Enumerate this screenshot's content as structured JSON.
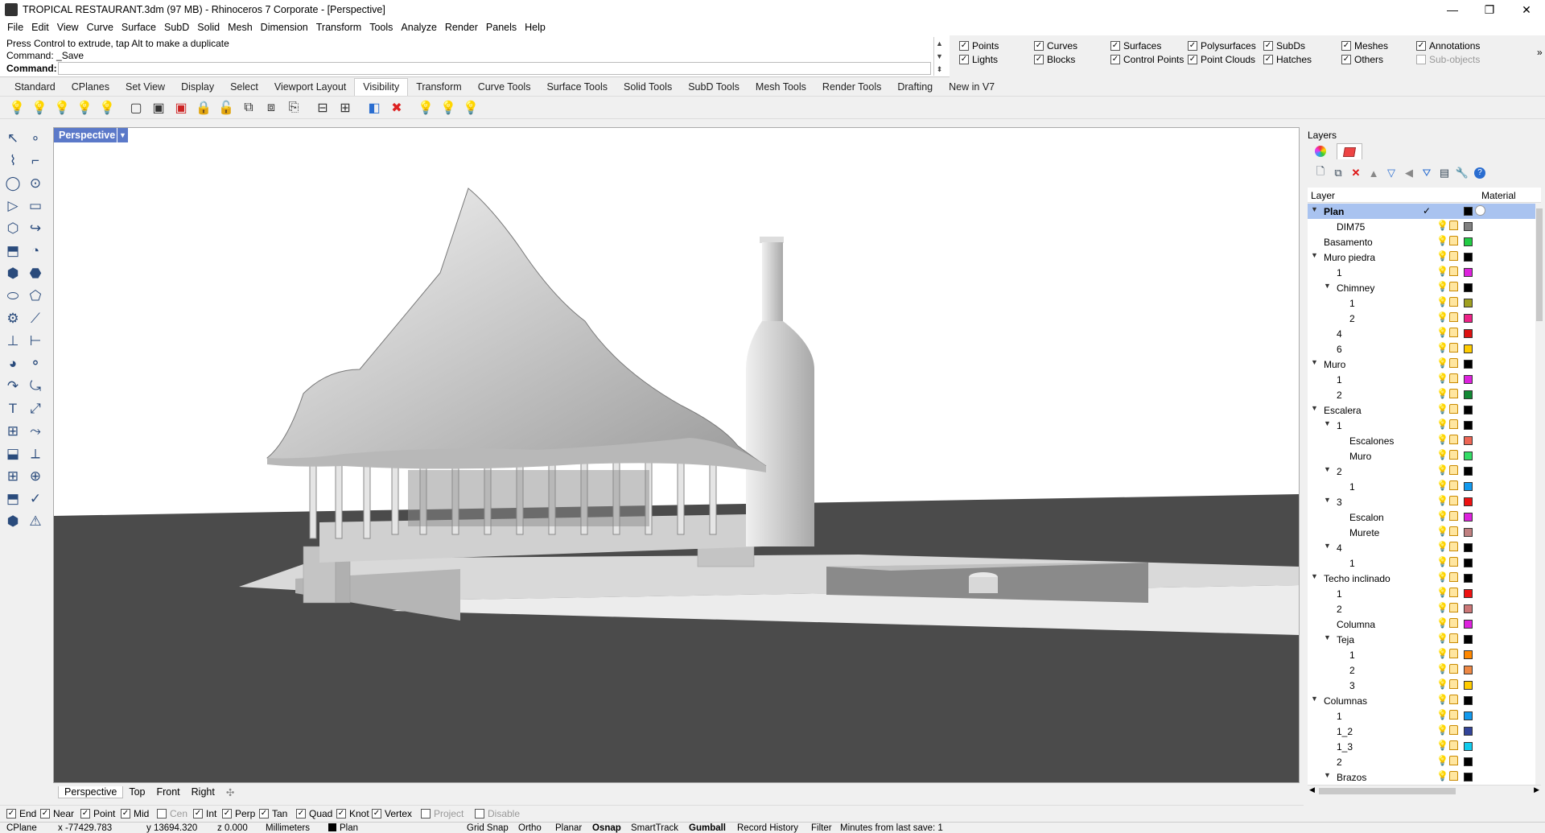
{
  "window": {
    "title": "TROPICAL RESTAURANT.3dm (97 MB) - Rhinoceros 7 Corporate - [Perspective]",
    "minimize": "—",
    "restore": "❐",
    "close": "✕"
  },
  "menu": [
    "File",
    "Edit",
    "View",
    "Curve",
    "Surface",
    "SubD",
    "Solid",
    "Mesh",
    "Dimension",
    "Transform",
    "Tools",
    "Analyze",
    "Render",
    "Panels",
    "Help"
  ],
  "command": {
    "history1": "Press Control to extrude, tap Alt to make a duplicate",
    "history2": "Command: _Save",
    "prompt": "Command:",
    "value": ""
  },
  "select_filter": [
    {
      "label": "Points",
      "checked": true
    },
    {
      "label": "Lights",
      "checked": true
    },
    {
      "label": "Curves",
      "checked": true
    },
    {
      "label": "Blocks",
      "checked": true
    },
    {
      "label": "Surfaces",
      "checked": true
    },
    {
      "label": "Control Points",
      "checked": true
    },
    {
      "label": "Polysurfaces",
      "checked": true
    },
    {
      "label": "Point Clouds",
      "checked": true
    },
    {
      "label": "SubDs",
      "checked": true
    },
    {
      "label": "Hatches",
      "checked": true
    },
    {
      "label": "Meshes",
      "checked": true
    },
    {
      "label": "Others",
      "checked": true
    },
    {
      "label": "Annotations",
      "checked": true
    },
    {
      "label": "Sub-objects",
      "checked": false
    }
  ],
  "toolbar_tabs": [
    "Standard",
    "CPlanes",
    "Set View",
    "Display",
    "Select",
    "Viewport Layout",
    "Visibility",
    "Transform",
    "Curve Tools",
    "Surface Tools",
    "Solid Tools",
    "SubD Tools",
    "Mesh Tools",
    "Render Tools",
    "Drafting",
    "New in V7"
  ],
  "active_toolbar_tab": "Visibility",
  "viewport": {
    "label": "Perspective",
    "tabs": [
      "Perspective",
      "Top",
      "Front",
      "Right"
    ],
    "add_tab": "✣"
  },
  "osnaps": [
    {
      "label": "End",
      "checked": true
    },
    {
      "label": "Near",
      "checked": true
    },
    {
      "label": "Point",
      "checked": true
    },
    {
      "label": "Mid",
      "checked": true
    },
    {
      "label": "Cen",
      "checked": false
    },
    {
      "label": "Int",
      "checked": true
    },
    {
      "label": "Perp",
      "checked": true
    },
    {
      "label": "Tan",
      "checked": true
    },
    {
      "label": "Quad",
      "checked": true
    },
    {
      "label": "Knot",
      "checked": true
    },
    {
      "label": "Vertex",
      "checked": true
    },
    {
      "label": "Project",
      "checked": false
    },
    {
      "label": "Disable",
      "checked": false
    }
  ],
  "status": {
    "cplane": "CPlane",
    "x": "x -77429.783",
    "y": "y 13694.320",
    "z": "z 0.000",
    "units": "Millimeters",
    "layer": "Plan",
    "grid_snap": "Grid Snap",
    "ortho": "Ortho",
    "planar": "Planar",
    "osnap": "Osnap",
    "smarttrack": "SmartTrack",
    "gumball": "Gumball",
    "record_history": "Record History",
    "filter": "Filter",
    "last_save": "Minutes from last save: 1"
  },
  "layers_panel": {
    "title": "Layers",
    "col_layer": "Layer",
    "col_material": "Material",
    "rows": [
      {
        "name": "Plan",
        "indent": 0,
        "expander": "down",
        "color": "#000000",
        "selected": true,
        "current": true
      },
      {
        "name": "DIM75",
        "indent": 1,
        "expander": "",
        "color": "#808080"
      },
      {
        "name": "Basamento",
        "indent": 0,
        "expander": "",
        "color": "#22cc44"
      },
      {
        "name": "Muro piedra",
        "indent": 0,
        "expander": "down",
        "color": "#000000"
      },
      {
        "name": "1",
        "indent": 1,
        "expander": "",
        "color": "#dd22dd"
      },
      {
        "name": "Chimney",
        "indent": 1,
        "expander": "down",
        "color": "#000000"
      },
      {
        "name": "1",
        "indent": 2,
        "expander": "",
        "color": "#a0a020"
      },
      {
        "name": "2",
        "indent": 2,
        "expander": "",
        "color": "#ee2288"
      },
      {
        "name": "4",
        "indent": 1,
        "expander": "",
        "color": "#dd1111"
      },
      {
        "name": "6",
        "indent": 1,
        "expander": "",
        "color": "#ffcc00"
      },
      {
        "name": "Muro",
        "indent": 0,
        "expander": "down",
        "color": "#000000"
      },
      {
        "name": "1",
        "indent": 1,
        "expander": "",
        "color": "#dd22dd"
      },
      {
        "name": "2",
        "indent": 1,
        "expander": "",
        "color": "#118833"
      },
      {
        "name": "Escalera",
        "indent": 0,
        "expander": "down",
        "color": "#000000"
      },
      {
        "name": "1",
        "indent": 1,
        "expander": "down",
        "color": "#000000"
      },
      {
        "name": "Escalones",
        "indent": 2,
        "expander": "",
        "color": "#ee6655"
      },
      {
        "name": "Muro",
        "indent": 2,
        "expander": "",
        "color": "#33dd66"
      },
      {
        "name": "2",
        "indent": 1,
        "expander": "down",
        "color": "#000000"
      },
      {
        "name": "1",
        "indent": 2,
        "expander": "",
        "color": "#1199ee"
      },
      {
        "name": "3",
        "indent": 1,
        "expander": "down",
        "color": "#ee1111"
      },
      {
        "name": "Escalon",
        "indent": 2,
        "expander": "",
        "color": "#dd22dd"
      },
      {
        "name": "Murete",
        "indent": 2,
        "expander": "",
        "color": "#c08080"
      },
      {
        "name": "4",
        "indent": 1,
        "expander": "down",
        "color": "#000000"
      },
      {
        "name": "1",
        "indent": 2,
        "expander": "",
        "color": "#000000"
      },
      {
        "name": "Techo inclinado",
        "indent": 0,
        "expander": "down",
        "color": "#000000"
      },
      {
        "name": "1",
        "indent": 1,
        "expander": "",
        "color": "#ee1111"
      },
      {
        "name": "2",
        "indent": 1,
        "expander": "",
        "color": "#cc7777"
      },
      {
        "name": "Columna",
        "indent": 1,
        "expander": "",
        "color": "#dd22dd"
      },
      {
        "name": "Teja",
        "indent": 1,
        "expander": "down",
        "color": "#000000"
      },
      {
        "name": "1",
        "indent": 2,
        "expander": "",
        "color": "#ff8800"
      },
      {
        "name": "2",
        "indent": 2,
        "expander": "",
        "color": "#ee8844"
      },
      {
        "name": "3",
        "indent": 2,
        "expander": "",
        "color": "#ffcc00"
      },
      {
        "name": "Columnas",
        "indent": 0,
        "expander": "down",
        "color": "#000000"
      },
      {
        "name": "1",
        "indent": 1,
        "expander": "",
        "color": "#1199ee"
      },
      {
        "name": "1_2",
        "indent": 1,
        "expander": "",
        "color": "#334499"
      },
      {
        "name": "1_3",
        "indent": 1,
        "expander": "",
        "color": "#11ccee"
      },
      {
        "name": "2",
        "indent": 1,
        "expander": "",
        "color": "#000000"
      },
      {
        "name": "Brazos",
        "indent": 1,
        "expander": "down",
        "color": "#000000"
      }
    ]
  }
}
